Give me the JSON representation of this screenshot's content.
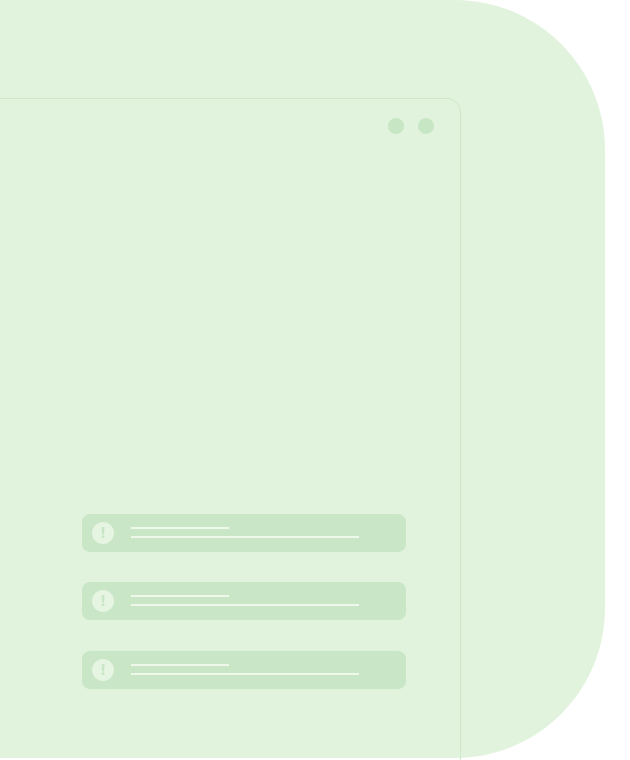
{
  "colors": {
    "backdrop": "#e2f3dd",
    "window_border": "#cfe8ca",
    "window_control": "#c7e6c4",
    "notification_bg": "#c9e6c7",
    "notification_badge": "#e6f5e2",
    "placeholder_line": "#eef8eb"
  },
  "window": {
    "controls": [
      {
        "icon": "window-control-dot-icon"
      },
      {
        "icon": "window-control-dot-icon"
      }
    ]
  },
  "notifications": [
    {
      "icon": "exclamation-icon",
      "glyph": "!"
    },
    {
      "icon": "exclamation-icon",
      "glyph": "!"
    },
    {
      "icon": "exclamation-icon",
      "glyph": "!"
    }
  ]
}
